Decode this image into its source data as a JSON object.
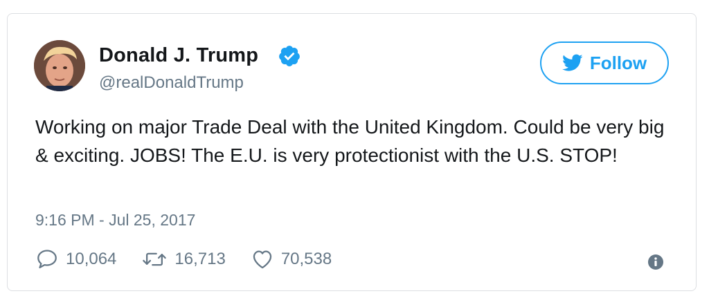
{
  "author": {
    "display_name": "Donald J. Trump",
    "handle": "@realDonaldTrump",
    "verified": true,
    "avatar_icon": "profile-photo"
  },
  "follow_button": {
    "label": "Follow",
    "icon": "twitter-bird-icon"
  },
  "tweet": {
    "text": "Working on major Trade Deal with the United Kingdom. Could be very big & exciting. JOBS! The E.U. is very protectionist with the U.S. STOP!",
    "timestamp": "9:16 PM - Jul 25, 2017"
  },
  "actions": {
    "replies": {
      "icon": "reply-icon",
      "count": "10,064"
    },
    "retweets": {
      "icon": "retweet-icon",
      "count": "16,713"
    },
    "likes": {
      "icon": "heart-icon",
      "count": "70,538"
    },
    "info": {
      "icon": "info-icon"
    }
  },
  "colors": {
    "accent": "#1da1f2",
    "text_primary": "#14171a",
    "text_secondary": "#657786",
    "border": "#dcdee2"
  }
}
